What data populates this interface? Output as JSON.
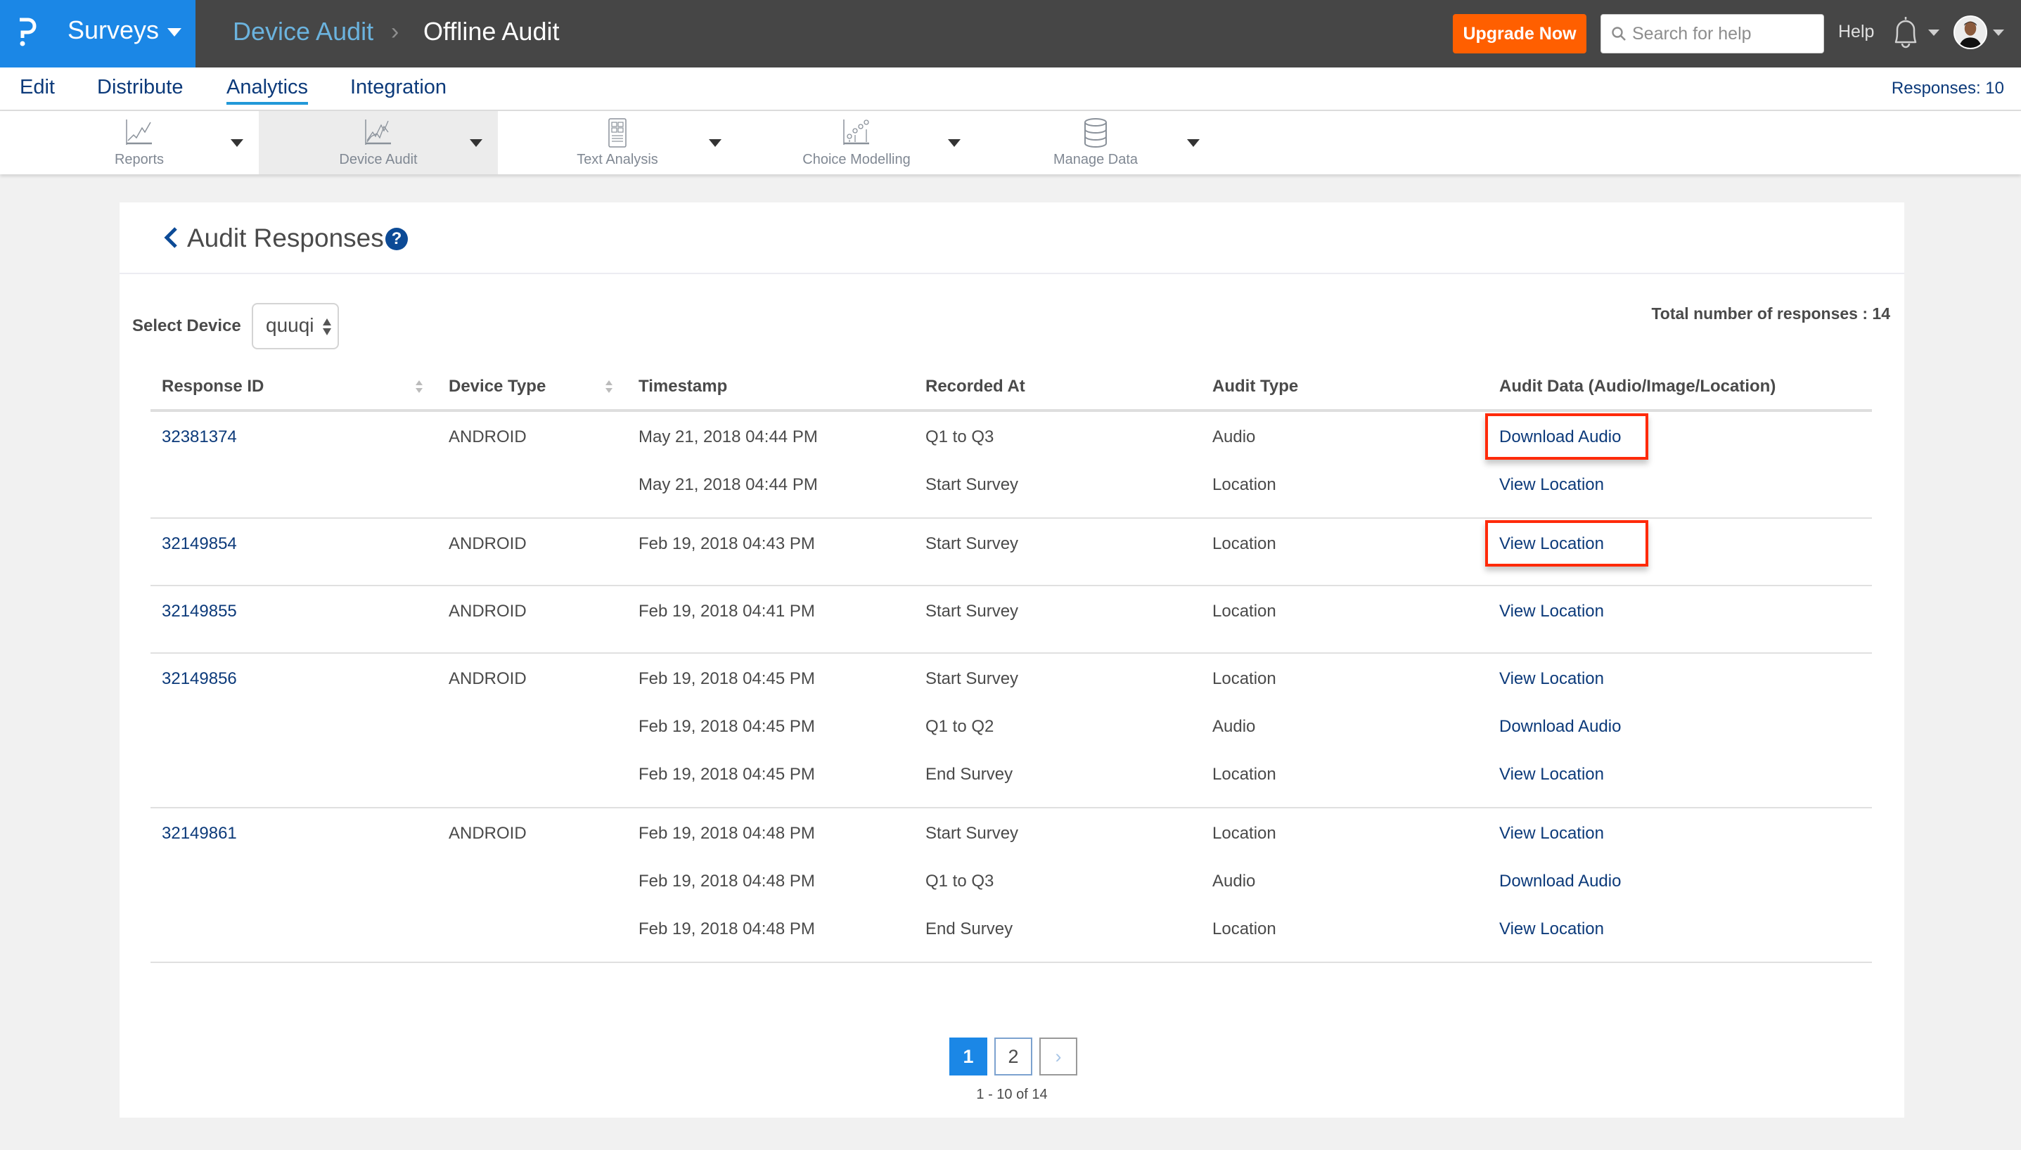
{
  "topbar": {
    "product": "Surveys",
    "breadcrumb": [
      "Device Audit",
      "Offline Audit"
    ],
    "upgrade_label": "Upgrade Now",
    "search_placeholder": "Search for help",
    "help_label": "Help",
    "brand_color": "#1b87e6",
    "upgrade_color": "#ff5f00"
  },
  "subnav": {
    "items": [
      "Edit",
      "Distribute",
      "Analytics",
      "Integration"
    ],
    "active": "Analytics",
    "responses_label": "Responses: 10"
  },
  "toolbar": {
    "items": [
      {
        "label": "Reports",
        "icon": "line-chart-icon"
      },
      {
        "label": "Device Audit",
        "icon": "multi-line-chart-icon",
        "active": true
      },
      {
        "label": "Text Analysis",
        "icon": "document-grid-icon"
      },
      {
        "label": "Choice Modelling",
        "icon": "scatter-chart-icon"
      },
      {
        "label": "Manage Data",
        "icon": "database-icon"
      }
    ]
  },
  "card": {
    "title": "Audit Responses",
    "help_glyph": "?",
    "select_label": "Select Device",
    "select_value": "quuqi",
    "total_label": "Total number of responses : 14"
  },
  "table": {
    "headers": [
      "Response ID",
      "Device Type",
      "Timestamp",
      "Recorded At",
      "Audit Type",
      "Audit Data (Audio/Image/Location)"
    ],
    "groups": [
      {
        "id": "32381374",
        "device": "ANDROID",
        "entries": [
          {
            "timestamp": "May 21, 2018 04:44 PM",
            "recorded_at": "Q1 to Q3",
            "audit_type": "Audio",
            "action": "Download Audio",
            "highlighted": true
          },
          {
            "timestamp": "May 21, 2018 04:44 PM",
            "recorded_at": "Start Survey",
            "audit_type": "Location",
            "action": "View Location"
          }
        ]
      },
      {
        "id": "32149854",
        "device": "ANDROID",
        "entries": [
          {
            "timestamp": "Feb 19, 2018 04:43 PM",
            "recorded_at": "Start Survey",
            "audit_type": "Location",
            "action": "View Location",
            "highlighted": true
          }
        ]
      },
      {
        "id": "32149855",
        "device": "ANDROID",
        "entries": [
          {
            "timestamp": "Feb 19, 2018 04:41 PM",
            "recorded_at": "Start Survey",
            "audit_type": "Location",
            "action": "View Location"
          }
        ]
      },
      {
        "id": "32149856",
        "device": "ANDROID",
        "entries": [
          {
            "timestamp": "Feb 19, 2018 04:45 PM",
            "recorded_at": "Start Survey",
            "audit_type": "Location",
            "action": "View Location"
          },
          {
            "timestamp": "Feb 19, 2018 04:45 PM",
            "recorded_at": "Q1 to Q2",
            "audit_type": "Audio",
            "action": "Download Audio"
          },
          {
            "timestamp": "Feb 19, 2018 04:45 PM",
            "recorded_at": "End Survey",
            "audit_type": "Location",
            "action": "View Location"
          }
        ]
      },
      {
        "id": "32149861",
        "device": "ANDROID",
        "entries": [
          {
            "timestamp": "Feb 19, 2018 04:48 PM",
            "recorded_at": "Start Survey",
            "audit_type": "Location",
            "action": "View Location"
          },
          {
            "timestamp": "Feb 19, 2018 04:48 PM",
            "recorded_at": "Q1 to Q3",
            "audit_type": "Audio",
            "action": "Download Audio"
          },
          {
            "timestamp": "Feb 19, 2018 04:48 PM",
            "recorded_at": "End Survey",
            "audit_type": "Location",
            "action": "View Location"
          }
        ]
      }
    ]
  },
  "pagination": {
    "pages": [
      "1",
      "2"
    ],
    "current": "1",
    "next_glyph": "›",
    "info": "1 - 10 of 14"
  }
}
